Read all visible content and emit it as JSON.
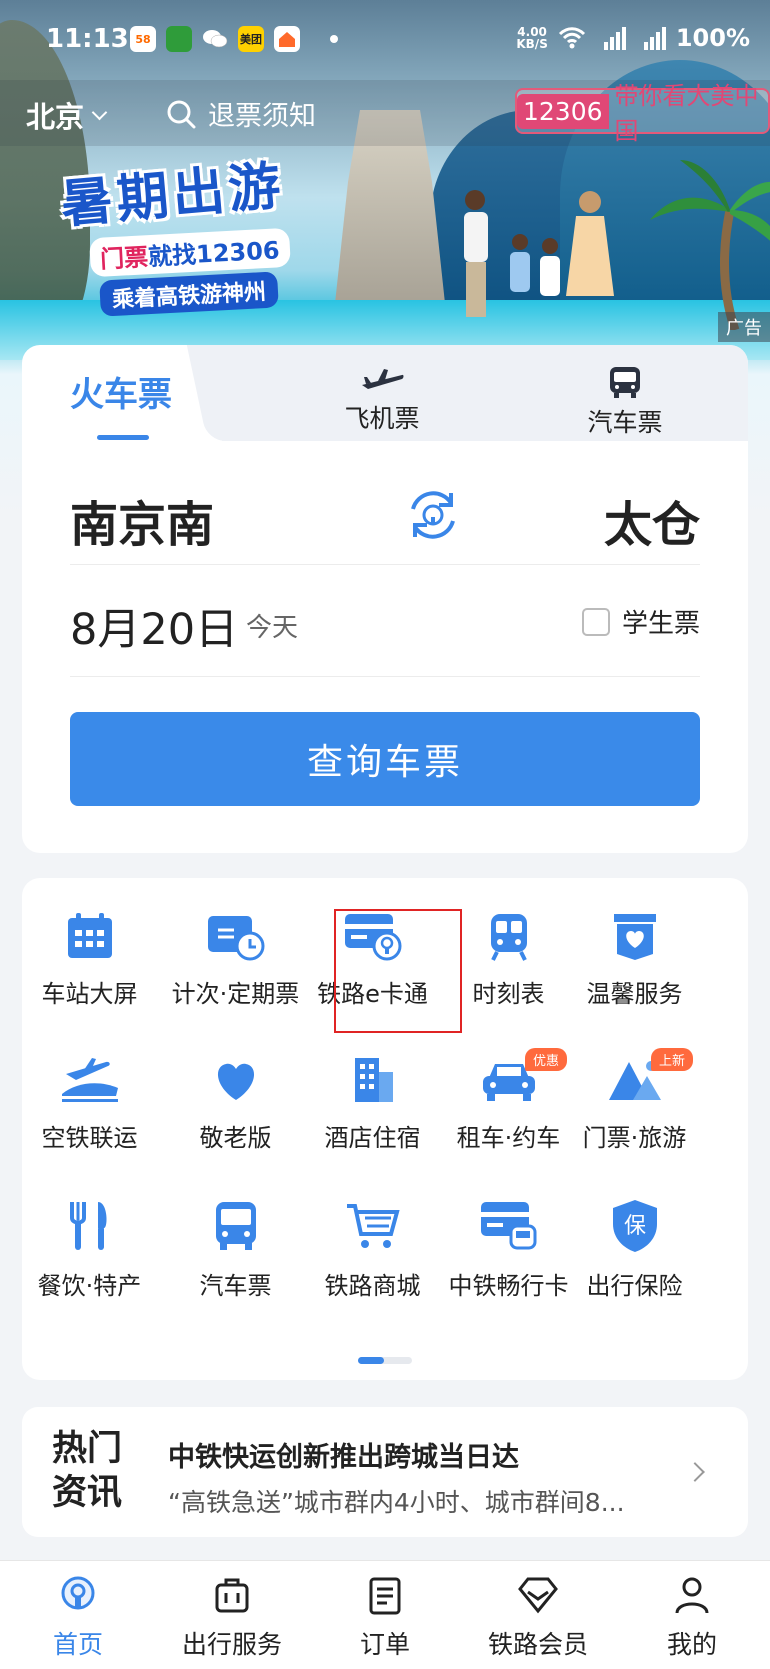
{
  "status_bar": {
    "time": "11:13",
    "net_speed_value": "4.00",
    "net_speed_unit": "KB/S",
    "signal1": "4G",
    "signal2": "4G",
    "battery": "100%",
    "app_icons": [
      {
        "name": "58",
        "color": "#ff6a00"
      },
      {
        "name": "",
        "color": "#2f9c3a"
      },
      {
        "name": "wechat",
        "color": "#ffffff"
      },
      {
        "name": "美团",
        "color": "#ffd100"
      },
      {
        "name": "",
        "color": "#ff6a2b"
      }
    ]
  },
  "header": {
    "city": "北京",
    "search_text": "退票须知",
    "brand_number": "12306",
    "brand_slogan": "带你看大美中国"
  },
  "banner": {
    "title": "暑期出游",
    "line1_highlight": "门票",
    "line1_rest": "就找12306",
    "line2": "乘着高铁游神州",
    "ad_label": "广告"
  },
  "ticket_card": {
    "tabs": [
      "火车票",
      "飞机票",
      "汽车票"
    ],
    "from_station": "南京南",
    "to_station": "太仓",
    "date": "8月20日",
    "day_label": "今天",
    "student_label": "学生票",
    "query_button": "查询车票"
  },
  "services": [
    {
      "label": "车站大屏",
      "icon": "calendar-icon"
    },
    {
      "label": "计次·定期票",
      "icon": "ticket-clock-icon"
    },
    {
      "label": "铁路e卡通",
      "icon": "rail-card-icon"
    },
    {
      "label": "时刻表",
      "icon": "train-front-icon"
    },
    {
      "label": "温馨服务",
      "icon": "heart-box-icon"
    },
    {
      "label": "空铁联运",
      "icon": "plane-train-icon"
    },
    {
      "label": "敬老版",
      "icon": "heart-icon"
    },
    {
      "label": "酒店住宿",
      "icon": "hotel-icon"
    },
    {
      "label": "租车·约车",
      "icon": "car-icon",
      "badge": "优惠"
    },
    {
      "label": "门票·旅游",
      "icon": "mountain-icon",
      "badge": "上新"
    },
    {
      "label": "餐饮·特产",
      "icon": "cutlery-icon"
    },
    {
      "label": "汽车票",
      "icon": "bus-icon"
    },
    {
      "label": "铁路商城",
      "icon": "cart-icon"
    },
    {
      "label": "中铁畅行卡",
      "icon": "train-card-icon"
    },
    {
      "label": "出行保险",
      "icon": "shield-icon"
    }
  ],
  "news": {
    "tag_line1": "热门",
    "tag_line2": "资讯",
    "title": "中铁快运创新推出跨城当日达",
    "subtitle": "“高铁急送”城市群内4小时、城市群间8..."
  },
  "bottom_nav": [
    "首页",
    "出行服务",
    "订单",
    "铁路会员",
    "我的"
  ],
  "colors": {
    "accent": "#3a86e8",
    "badge": "#ff6a3d",
    "highlight_box": "#e02424"
  }
}
